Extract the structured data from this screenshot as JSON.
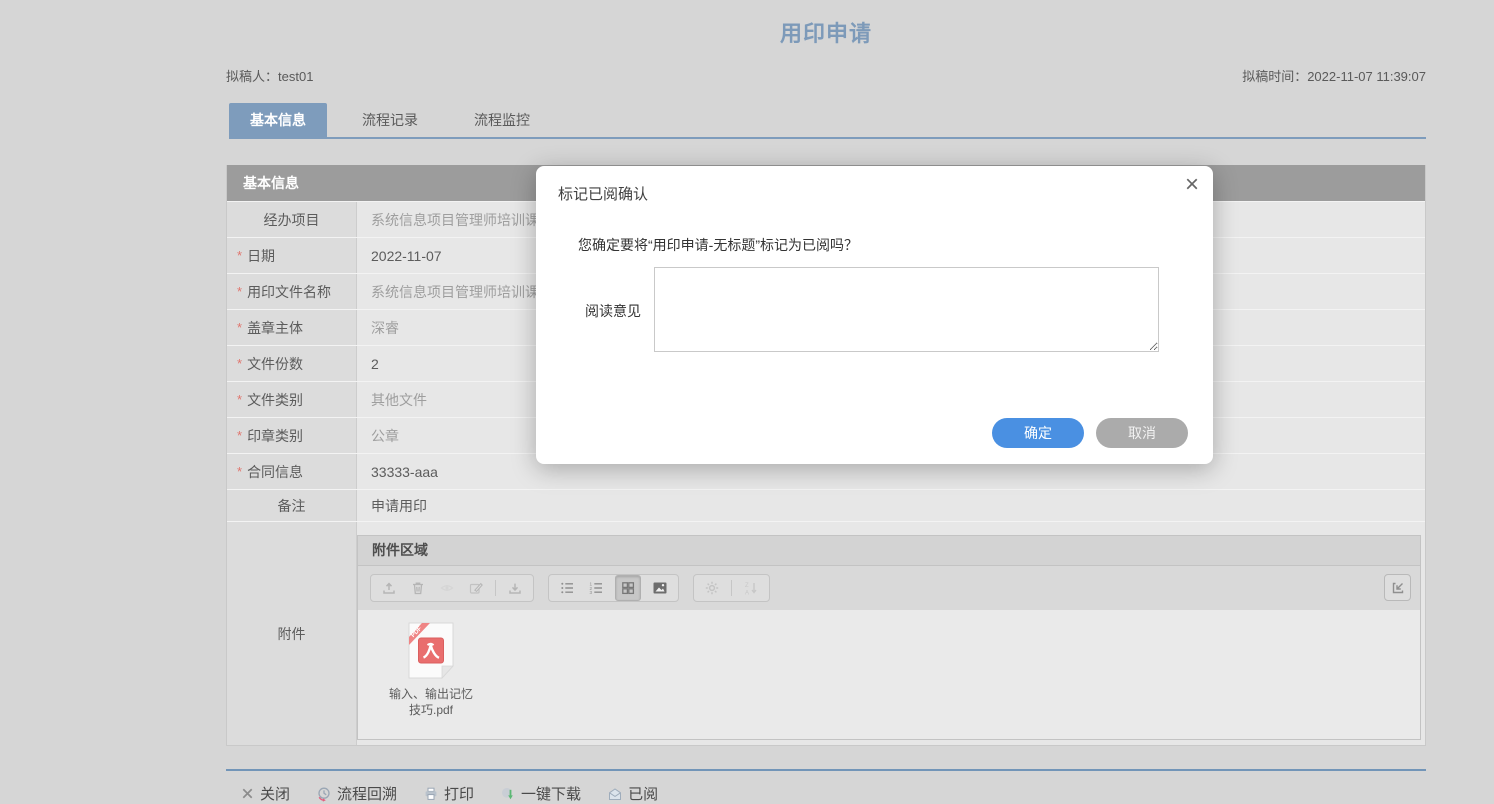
{
  "page": {
    "title": "用印申请"
  },
  "meta": {
    "drafter_label": "拟稿人：",
    "drafter": "test01",
    "time_label": "拟稿时间：",
    "time": "2022-11-07 11:39:07"
  },
  "tabs": [
    {
      "label": "基本信息",
      "active": true
    },
    {
      "label": "流程记录",
      "active": false
    },
    {
      "label": "流程监控",
      "active": false
    }
  ],
  "table": {
    "header": "基本信息"
  },
  "ui": {
    "required_marker": "*"
  },
  "fields": [
    {
      "label": "经办项目",
      "value": "系统信息项目管理师培训课",
      "required": false,
      "muted": true
    },
    {
      "label": "日期",
      "value": "2022-11-07",
      "required": true,
      "muted": false
    },
    {
      "label": "用印文件名称",
      "value": "系统信息项目管理师培训课",
      "required": true,
      "muted": true
    },
    {
      "label": "盖章主体",
      "value": "深睿",
      "required": true,
      "muted": true
    },
    {
      "label": "文件份数",
      "value": "2",
      "required": true,
      "muted": false
    },
    {
      "label": "文件类别",
      "value": "其他文件",
      "required": true,
      "muted": true
    },
    {
      "label": "印章类别",
      "value": "公章",
      "required": true,
      "muted": true
    },
    {
      "label": "合同信息",
      "value": "33333-aaa",
      "required": true,
      "muted": false
    },
    {
      "label": "备注",
      "value": "申请用印",
      "required": false,
      "muted": false
    }
  ],
  "attachment": {
    "row_label": "附件",
    "panel_title": "附件区域",
    "file": {
      "badge": "PDF",
      "line1": "输入、输出记忆",
      "line2": "技巧.pdf"
    }
  },
  "footer": {
    "actions": [
      {
        "icon": "close-x-icon",
        "label": "关闭"
      },
      {
        "icon": "history-clock-icon",
        "label": "流程回溯"
      },
      {
        "icon": "printer-icon",
        "label": "打印"
      },
      {
        "icon": "one-click-download-icon",
        "label": "一键下载"
      },
      {
        "icon": "read-mail-icon",
        "label": "已阅"
      }
    ]
  },
  "modal": {
    "title": "标记已阅确认",
    "close_glyph": "×",
    "message": "您确定要将“用印申请-无标题”标记为已阅吗？",
    "comment_label": "阅读意见",
    "confirm_label": "确定",
    "cancel_label": "取消"
  },
  "colors": {
    "accent_blue": "#7e9cbc",
    "confirm_blue": "#4a90e2",
    "cancel_gray": "#ababab",
    "required_red": "#e0756d",
    "pdf_red": "#e96e6e"
  }
}
